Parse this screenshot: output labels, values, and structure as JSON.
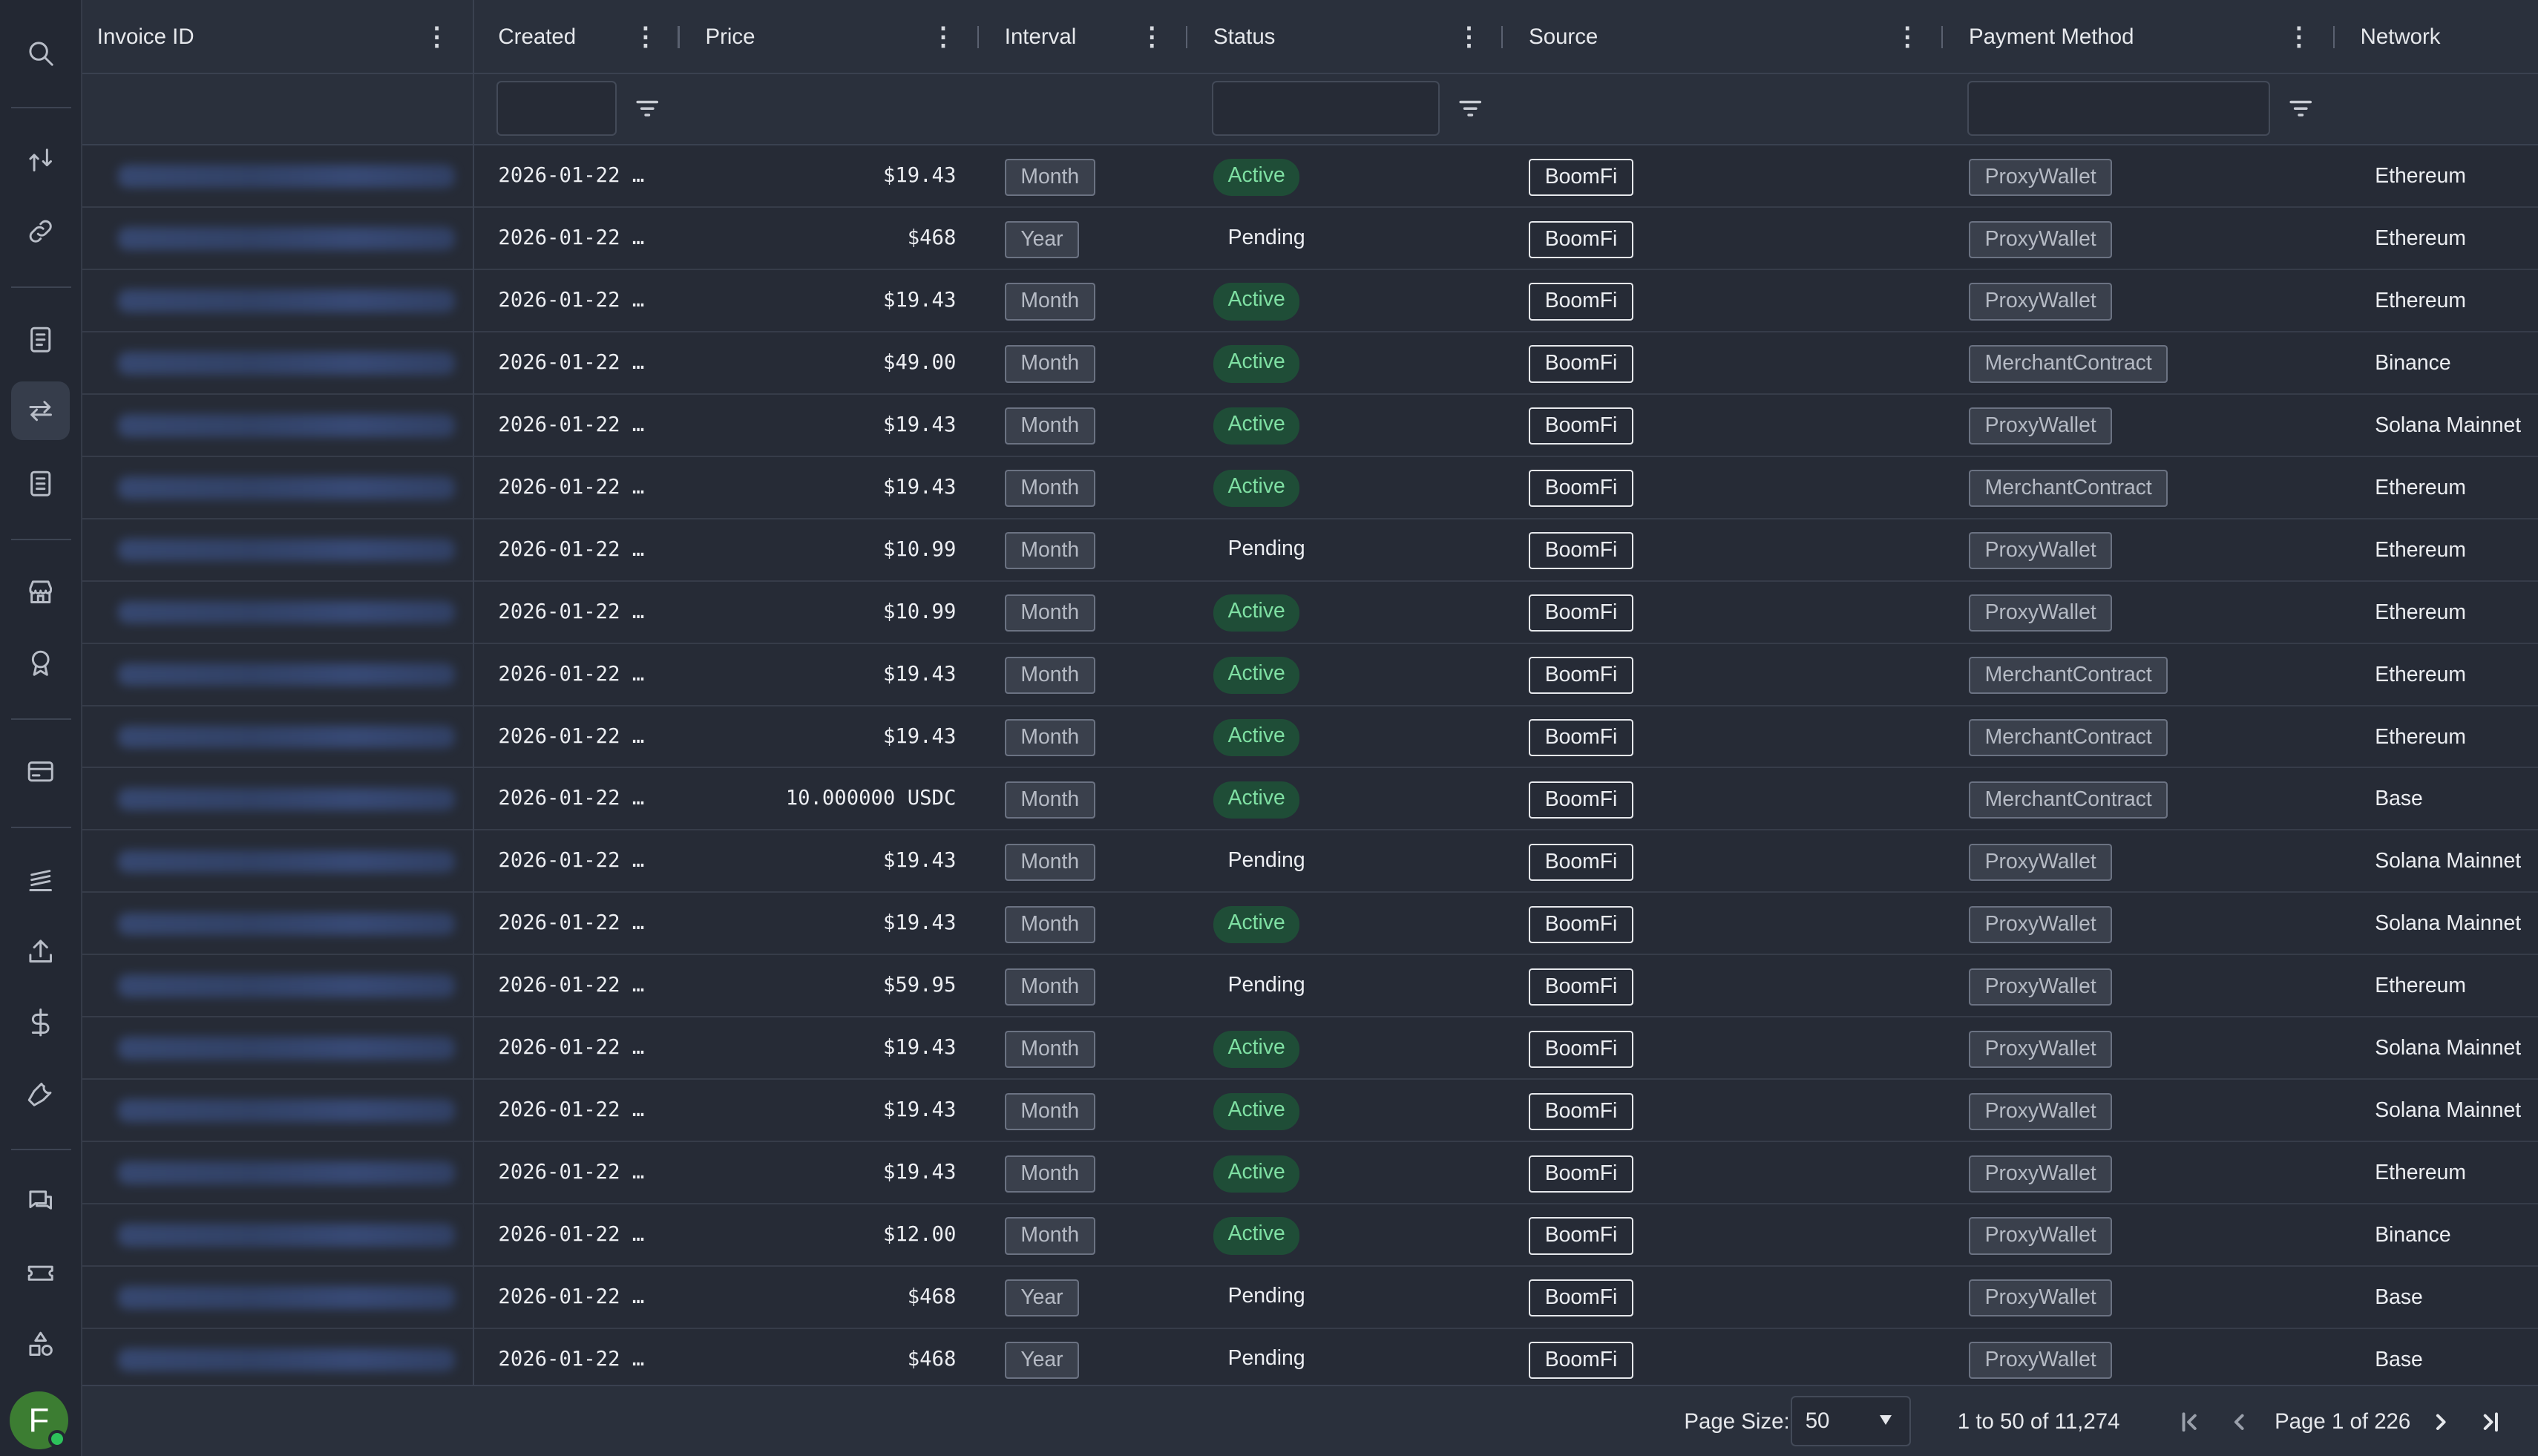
{
  "sidebar": {
    "icons": [
      {
        "name": "search-icon"
      },
      {
        "name": "transfer-arrows-icon"
      },
      {
        "name": "link-icon"
      },
      {
        "name": "invoice-icon"
      },
      {
        "name": "swap-icon"
      },
      {
        "name": "invoice-list-icon"
      },
      {
        "name": "store-icon"
      },
      {
        "name": "badge-icon"
      },
      {
        "name": "card-icon"
      },
      {
        "name": "stack-icon"
      },
      {
        "name": "upload-icon"
      },
      {
        "name": "dollar-icon"
      },
      {
        "name": "wrench-icon"
      },
      {
        "name": "chat-icon"
      },
      {
        "name": "ticket-icon"
      },
      {
        "name": "shapes-icon"
      }
    ],
    "active_icon": "swap-icon",
    "avatar_letter": "F",
    "avatar_color": "#3c7d32"
  },
  "table": {
    "columns": {
      "invoice_id": "Invoice ID",
      "created": "Created",
      "price": "Price",
      "interval": "Interval",
      "status": "Status",
      "source": "Source",
      "payment_method": "Payment Method",
      "network": "Network"
    },
    "rows": [
      {
        "created": "2026-01-22 …",
        "price": "$19.43",
        "interval": "Month",
        "status": "Active",
        "source": "BoomFi",
        "payment_method": "ProxyWallet",
        "network": "Ethereum"
      },
      {
        "created": "2026-01-22 …",
        "price": "$468",
        "interval": "Year",
        "status": "Pending",
        "source": "BoomFi",
        "payment_method": "ProxyWallet",
        "network": "Ethereum"
      },
      {
        "created": "2026-01-22 …",
        "price": "$19.43",
        "interval": "Month",
        "status": "Active",
        "source": "BoomFi",
        "payment_method": "ProxyWallet",
        "network": "Ethereum"
      },
      {
        "created": "2026-01-22 …",
        "price": "$49.00",
        "interval": "Month",
        "status": "Active",
        "source": "BoomFi",
        "payment_method": "MerchantContract",
        "network": "Binance"
      },
      {
        "created": "2026-01-22 …",
        "price": "$19.43",
        "interval": "Month",
        "status": "Active",
        "source": "BoomFi",
        "payment_method": "ProxyWallet",
        "network": "Solana Mainnet"
      },
      {
        "created": "2026-01-22 …",
        "price": "$19.43",
        "interval": "Month",
        "status": "Active",
        "source": "BoomFi",
        "payment_method": "MerchantContract",
        "network": "Ethereum"
      },
      {
        "created": "2026-01-22 …",
        "price": "$10.99",
        "interval": "Month",
        "status": "Pending",
        "source": "BoomFi",
        "payment_method": "ProxyWallet",
        "network": "Ethereum"
      },
      {
        "created": "2026-01-22 …",
        "price": "$10.99",
        "interval": "Month",
        "status": "Active",
        "source": "BoomFi",
        "payment_method": "ProxyWallet",
        "network": "Ethereum"
      },
      {
        "created": "2026-01-22 …",
        "price": "$19.43",
        "interval": "Month",
        "status": "Active",
        "source": "BoomFi",
        "payment_method": "MerchantContract",
        "network": "Ethereum"
      },
      {
        "created": "2026-01-22 …",
        "price": "$19.43",
        "interval": "Month",
        "status": "Active",
        "source": "BoomFi",
        "payment_method": "MerchantContract",
        "network": "Ethereum"
      },
      {
        "created": "2026-01-22 …",
        "price": "10.000000 USDC",
        "interval": "Month",
        "status": "Active",
        "source": "BoomFi",
        "payment_method": "MerchantContract",
        "network": "Base"
      },
      {
        "created": "2026-01-22 …",
        "price": "$19.43",
        "interval": "Month",
        "status": "Pending",
        "source": "BoomFi",
        "payment_method": "ProxyWallet",
        "network": "Solana Mainnet"
      },
      {
        "created": "2026-01-22 …",
        "price": "$19.43",
        "interval": "Month",
        "status": "Active",
        "source": "BoomFi",
        "payment_method": "ProxyWallet",
        "network": "Solana Mainnet"
      },
      {
        "created": "2026-01-22 …",
        "price": "$59.95",
        "interval": "Month",
        "status": "Pending",
        "source": "BoomFi",
        "payment_method": "ProxyWallet",
        "network": "Ethereum"
      },
      {
        "created": "2026-01-22 …",
        "price": "$19.43",
        "interval": "Month",
        "status": "Active",
        "source": "BoomFi",
        "payment_method": "ProxyWallet",
        "network": "Solana Mainnet"
      },
      {
        "created": "2026-01-22 …",
        "price": "$19.43",
        "interval": "Month",
        "status": "Active",
        "source": "BoomFi",
        "payment_method": "ProxyWallet",
        "network": "Solana Mainnet"
      },
      {
        "created": "2026-01-22 …",
        "price": "$19.43",
        "interval": "Month",
        "status": "Active",
        "source": "BoomFi",
        "payment_method": "ProxyWallet",
        "network": "Ethereum"
      },
      {
        "created": "2026-01-22 …",
        "price": "$12.00",
        "interval": "Month",
        "status": "Active",
        "source": "BoomFi",
        "payment_method": "ProxyWallet",
        "network": "Binance"
      },
      {
        "created": "2026-01-22 …",
        "price": "$468",
        "interval": "Year",
        "status": "Pending",
        "source": "BoomFi",
        "payment_method": "ProxyWallet",
        "network": "Base"
      },
      {
        "created": "2026-01-22 …",
        "price": "$468",
        "interval": "Year",
        "status": "Pending",
        "source": "BoomFi",
        "payment_method": "ProxyWallet",
        "network": "Base"
      }
    ]
  },
  "pagination": {
    "page_size_label": "Page Size:",
    "page_size_value": "50",
    "range_text": "1 to 50 of 11,274",
    "page_text": "Page 1 of 226"
  },
  "colors": {
    "background": "#262b36",
    "active_badge_bg": "#1f4d37",
    "active_badge_text": "#7fe0a3"
  }
}
